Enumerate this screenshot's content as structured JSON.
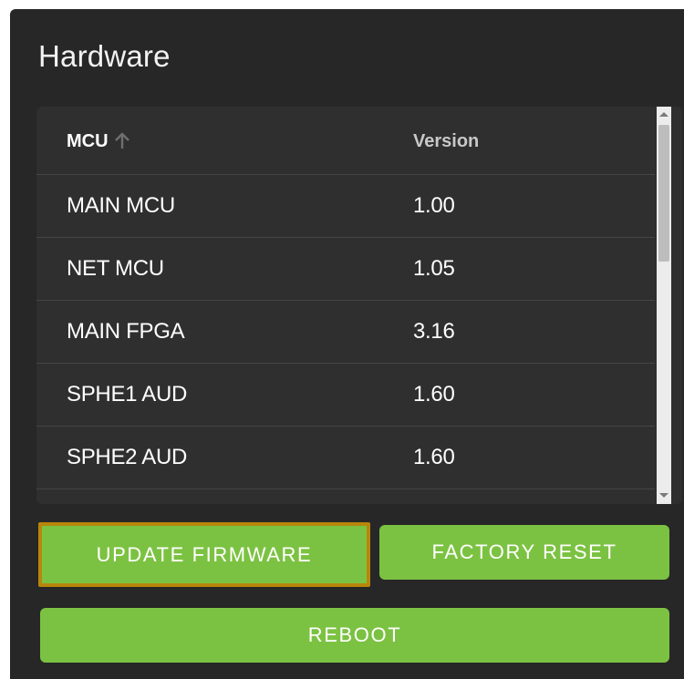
{
  "panel": {
    "title": "Hardware"
  },
  "table": {
    "columns": [
      {
        "label": "MCU",
        "sort": "ascending"
      },
      {
        "label": "Version"
      }
    ],
    "rows": [
      {
        "name": "MAIN MCU",
        "version": "1.00"
      },
      {
        "name": "NET MCU",
        "version": "1.05"
      },
      {
        "name": "MAIN FPGA",
        "version": "3.16"
      },
      {
        "name": "SPHE1 AUD",
        "version": "1.60"
      },
      {
        "name": "SPHE2 AUD",
        "version": "1.60"
      }
    ]
  },
  "buttons": {
    "update_firmware": "UPDATE FIRMWARE",
    "factory_reset": "FACTORY RESET",
    "reboot": "REBOOT"
  },
  "icons": {
    "sort": "arrow-up-icon"
  },
  "colors": {
    "panel_bg": "#272727",
    "table_bg": "#2f2f2f",
    "button_bg": "#7cc242",
    "focus_border": "#b8860b"
  }
}
